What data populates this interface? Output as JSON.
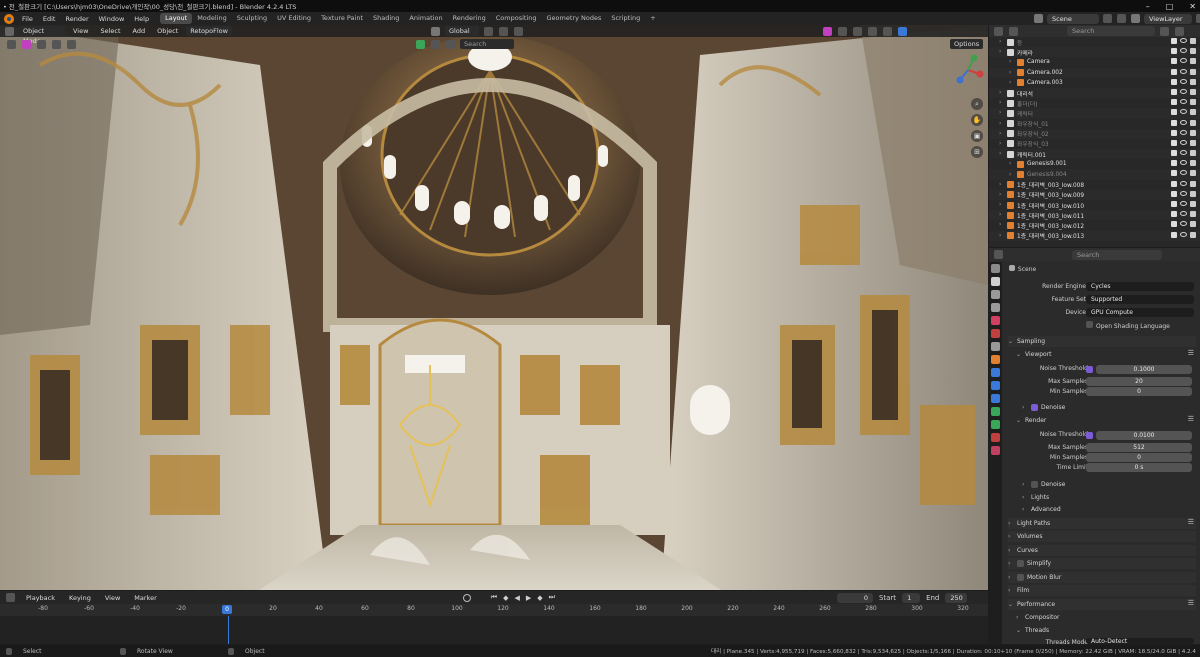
{
  "window": {
    "title": "• 천_철판크기 [C:\\Users\\hjm03\\OneDrive\\개인작\\00_성당\\천_철판크기.blend] - Blender 4.2.4 LTS",
    "controls": [
      "–",
      "□",
      "✕"
    ]
  },
  "menu": [
    "File",
    "Edit",
    "Render",
    "Window",
    "Help"
  ],
  "workspaces": [
    "Layout",
    "Modeling",
    "Sculpting",
    "UV Editing",
    "Texture Paint",
    "Shading",
    "Animation",
    "Rendering",
    "Compositing",
    "Geometry Nodes",
    "Scripting",
    "+"
  ],
  "active_workspace": "Layout",
  "scene": {
    "name": "Scene",
    "view_layer": "ViewLayer"
  },
  "viewport": {
    "mode": "Object Mode",
    "menus": [
      "View",
      "Select",
      "Add",
      "Object"
    ],
    "retopo": "RetopoFlow",
    "transform": "Global",
    "options": "Options",
    "search_placeholder": "Search",
    "colors": {
      "ceiling": "#5a4632",
      "marble": "#d8d2c4",
      "gold": "#b5893e",
      "sky": "#f4f2ea"
    }
  },
  "timeline": {
    "menus": [
      "Playback",
      "Keying",
      "View",
      "Marker"
    ],
    "current_frame": "0",
    "start_label": "Start",
    "start": "1",
    "end_label": "End",
    "end": "250",
    "ticks": [
      "-80",
      "-60",
      "-40",
      "-20",
      "0",
      "20",
      "40",
      "60",
      "80",
      "100",
      "120",
      "140",
      "160",
      "180",
      "200",
      "220",
      "240",
      "260",
      "280",
      "300",
      "320"
    ]
  },
  "status": {
    "left": [
      "Select",
      "Rotate View",
      "Object"
    ],
    "right": "대리 | Plane.345 | Verts:4,955,719 | Faces:5,660,832 | Tris:9,534,625 | Objects:1/5,166 | Duration: 00:10+10 (Frame 0/250) | Memory: 22.42 GiB | VRAM: 18.5/24.0 GiB | 4.2.4"
  },
  "outliner": {
    "search_placeholder": "Search",
    "rows": [
      {
        "label": "등",
        "indent": 1,
        "color": "#888888"
      },
      {
        "label": "카메라",
        "indent": 1,
        "color": "#e0e0e0"
      },
      {
        "label": "Camera",
        "indent": 2,
        "color": "#e0e0e0"
      },
      {
        "label": "Camera.002",
        "indent": 2,
        "color": "#e0e0e0"
      },
      {
        "label": "Camera.003",
        "indent": 2,
        "color": "#e0e0e0"
      },
      {
        "label": "대리석",
        "indent": 1,
        "color": "#e0e0e0"
      },
      {
        "label": "홀더(더)",
        "indent": 1,
        "color": "#888888"
      },
      {
        "label": "캐릭터",
        "indent": 1,
        "color": "#888888"
      },
      {
        "label": "좌우장식_01",
        "indent": 1,
        "color": "#888888"
      },
      {
        "label": "좌우장식_02",
        "indent": 1,
        "color": "#888888"
      },
      {
        "label": "좌우장식_03",
        "indent": 1,
        "color": "#888888"
      },
      {
        "label": "캐릭터.001",
        "indent": 1,
        "color": "#e0e0e0"
      },
      {
        "label": "Genesis9.001",
        "indent": 2,
        "color": "#e0e0e0"
      },
      {
        "label": "Genesis9.004",
        "indent": 2,
        "color": "#888888"
      },
      {
        "label": "1층_대리벽_003_low.008",
        "indent": 1,
        "color": "#e0e0e0"
      },
      {
        "label": "1층_대리벽_003_low.009",
        "indent": 1,
        "color": "#e0e0e0"
      },
      {
        "label": "1층_대리벽_003_low.010",
        "indent": 1,
        "color": "#e0e0e0"
      },
      {
        "label": "1층_대리벽_003_low.011",
        "indent": 1,
        "color": "#e0e0e0"
      },
      {
        "label": "1층_대리벽_003_low.012",
        "indent": 1,
        "color": "#e0e0e0"
      },
      {
        "label": "1층_대리벽_003_low.013",
        "indent": 1,
        "color": "#e0e0e0"
      }
    ]
  },
  "properties": {
    "search_placeholder": "Search",
    "scene_label": "Scene",
    "render_engine_label": "Render Engine",
    "render_engine": "Cycles",
    "feature_set_label": "Feature Set",
    "feature_set": "Supported",
    "device_label": "Device",
    "device": "GPU Compute",
    "osl_label": "Open Shading Language",
    "sampling": "Sampling",
    "viewport": "Viewport",
    "noise_threshold_label": "Noise Threshold",
    "vp_noise_threshold": "0.1000",
    "max_samples_label": "Max Samples",
    "vp_max_samples": "20",
    "min_samples_label": "Min Samples",
    "vp_min_samples": "0",
    "denoise": "Denoise",
    "render": "Render",
    "r_noise_threshold": "0.0100",
    "r_max_samples": "512",
    "r_min_samples": "0",
    "time_limit_label": "Time Limit",
    "r_time_limit": "0 s",
    "lights": "Lights",
    "advanced": "Advanced",
    "light_paths": "Light Paths",
    "volumes": "Volumes",
    "curves": "Curves",
    "simplify": "Simplify",
    "motion_blur": "Motion Blur",
    "film": "Film",
    "performance": "Performance",
    "compositor": "Compositor",
    "threads": "Threads",
    "threads_mode_label": "Threads Mode",
    "threads_mode": "Auto-Detect"
  }
}
